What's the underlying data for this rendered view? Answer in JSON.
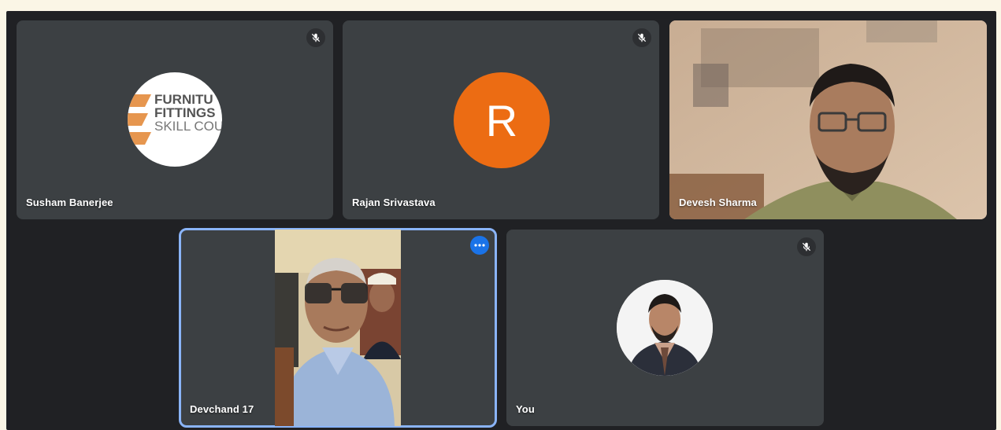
{
  "participants": [
    {
      "name": "Susham Banerjee",
      "muted": true,
      "tile": "logo",
      "logo_lines": [
        "FURNITU",
        "FITTINGS",
        "SKILL COU"
      ]
    },
    {
      "name": "Rajan Srivastava",
      "muted": true,
      "tile": "initial",
      "initial": "R"
    },
    {
      "name": "Devesh Sharma",
      "muted": false,
      "tile": "video"
    },
    {
      "name": "Devchand 17",
      "muted": false,
      "tile": "video",
      "speaking": true
    },
    {
      "name": "You",
      "muted": true,
      "tile": "photo"
    }
  ],
  "icons": {
    "muted": "mic-off-icon",
    "more": "more-options-icon"
  },
  "colors": {
    "stage": "#202124",
    "tile": "#3c4043",
    "initial_avatar": "#ec6c13",
    "active_border": "#8ab4f8",
    "more_button": "#1a73e8"
  }
}
